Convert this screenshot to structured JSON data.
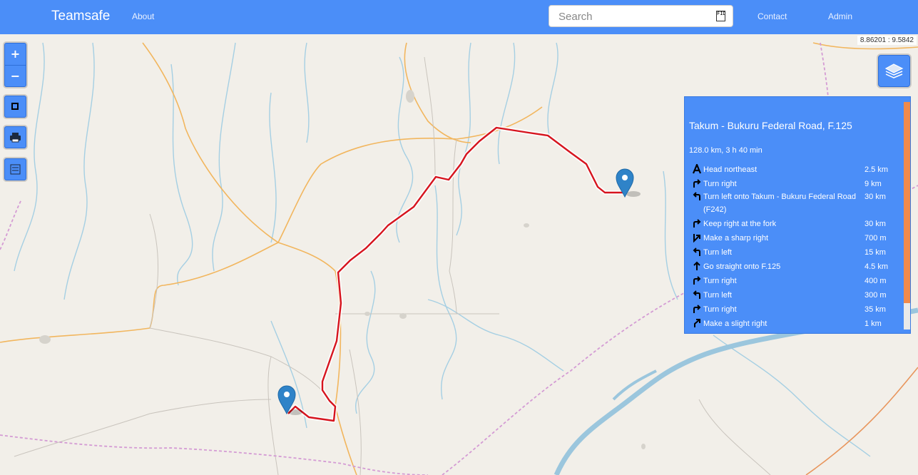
{
  "navbar": {
    "brand": "Teamsafe",
    "about": "About",
    "contact": "Contact",
    "admin": "Admin",
    "search_placeholder": "Search",
    "search_icon_text": "FIDB"
  },
  "map": {
    "coordinates": "8.86201 : 9.5842",
    "controls": {
      "zoom_in": "+",
      "zoom_out": "−"
    }
  },
  "route": {
    "title": "Takum - Bukuru Federal Road, F.125",
    "summary": "128.0 km, 3 h 40 min",
    "instructions": [
      {
        "icon": "depart-icon",
        "text": "Head northeast",
        "distance": "2.5 km"
      },
      {
        "icon": "turn-right-icon",
        "text": "Turn right",
        "distance": "9 km"
      },
      {
        "icon": "turn-left-icon",
        "text": "Turn left onto Takum - Bukuru Federal Road (F242)",
        "distance": "30 km"
      },
      {
        "icon": "turn-right-icon",
        "text": "Keep right at the fork",
        "distance": "30 km"
      },
      {
        "icon": "sharp-right-icon",
        "text": "Make a sharp right",
        "distance": "700 m"
      },
      {
        "icon": "turn-left-icon",
        "text": "Turn left",
        "distance": "15 km"
      },
      {
        "icon": "straight-icon",
        "text": "Go straight onto F.125",
        "distance": "4.5 km"
      },
      {
        "icon": "turn-right-icon",
        "text": "Turn right",
        "distance": "400 m"
      },
      {
        "icon": "turn-left-icon",
        "text": "Turn left",
        "distance": "300 m"
      },
      {
        "icon": "turn-right-icon",
        "text": "Turn right",
        "distance": "35 km"
      },
      {
        "icon": "slight-right-icon",
        "text": "Make a slight right",
        "distance": "1 km"
      }
    ]
  },
  "colors": {
    "navbar": "#4b8ef8",
    "route_line": "#d6141e",
    "scroll_thumb": "#f08a4b",
    "marker": "#2f83c8"
  }
}
